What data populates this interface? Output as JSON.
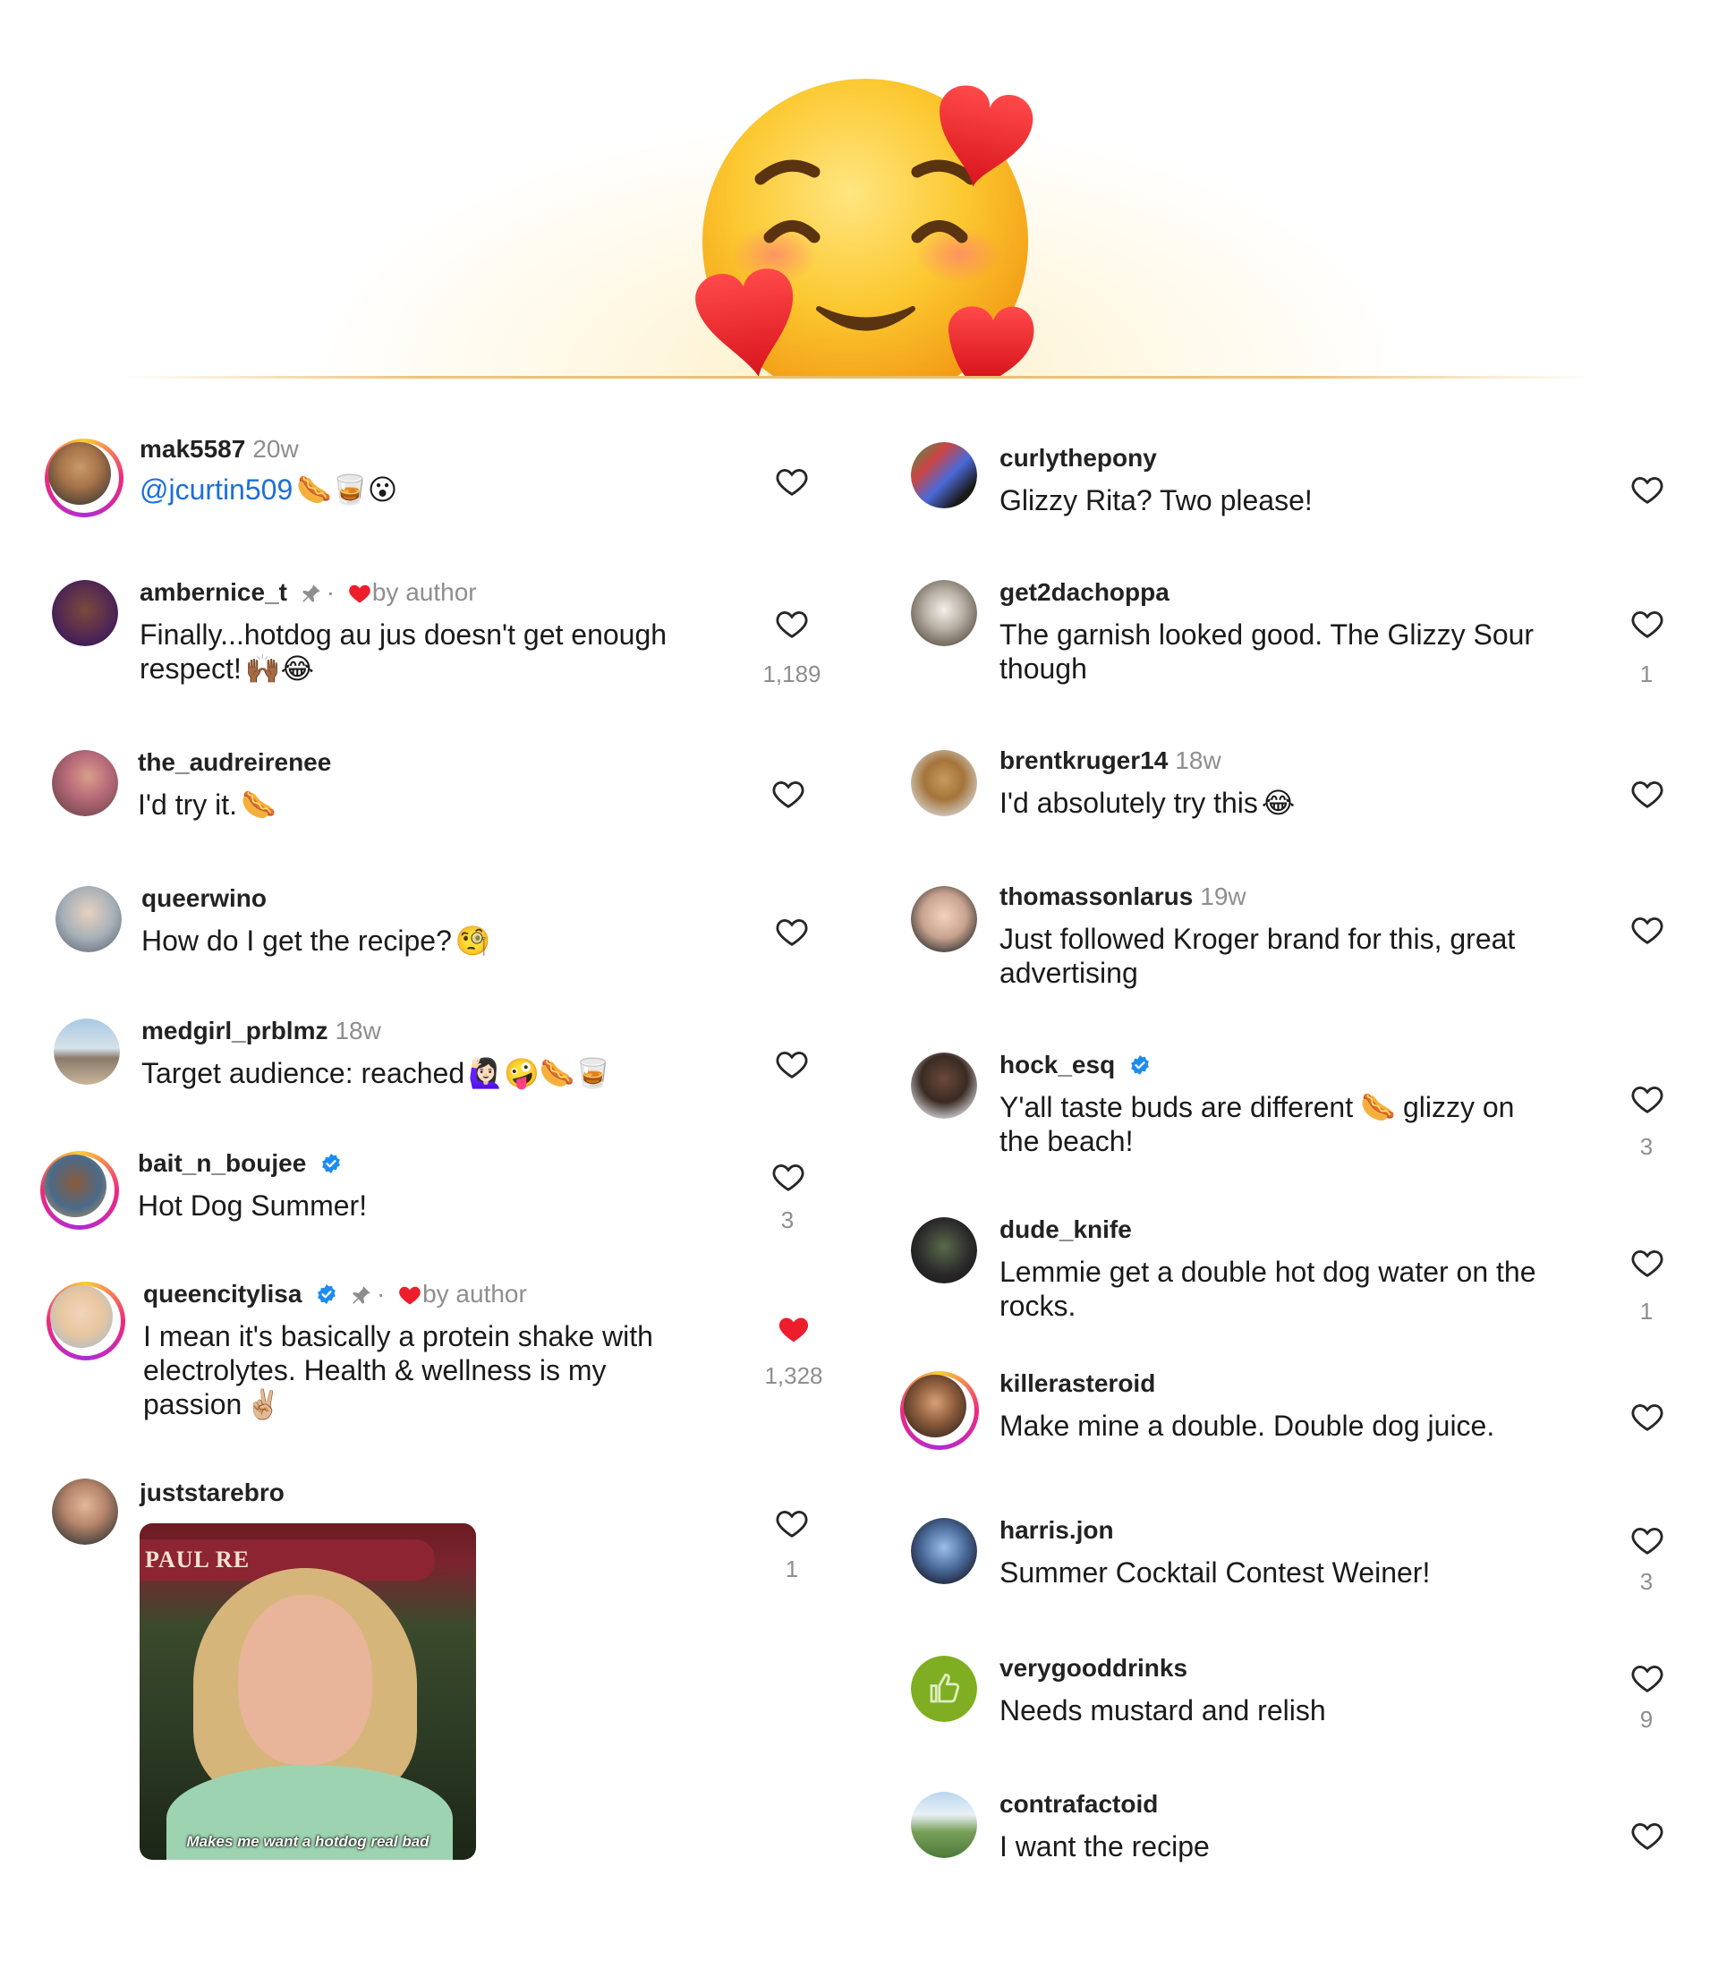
{
  "left_comments": [
    {
      "username": "mak5587",
      "time": "20w",
      "text": "@jcurtin509",
      "mention": true,
      "emoji": "🌭🥃😮",
      "likes": ""
    },
    {
      "username": "ambernice_t",
      "pinned": true,
      "author_liked": "by author",
      "text": "Finally...hotdog au jus doesn't get enough",
      "text2": "respect!",
      "emoji2": "🙌🏾😂",
      "likes": "1,189"
    },
    {
      "username": "the_audreirenee",
      "text": "I'd try it.",
      "emoji": "🌭",
      "likes": ""
    },
    {
      "username": "queerwino",
      "text": "How do I get the recipe?",
      "emoji": "🧐",
      "likes": ""
    },
    {
      "username": "medgirl_prblmz",
      "time": "18w",
      "text": "Target audience: reached",
      "emoji": "🙋🏻‍♀️🤪🌭🥃",
      "likes": ""
    },
    {
      "username": "bait_n_boujee",
      "verified": true,
      "text": "Hot Dog Summer!",
      "likes": "3"
    },
    {
      "username": "queencitylisa",
      "verified": true,
      "pinned": true,
      "author_liked": "by author",
      "text": "I mean it's basically a protein shake with",
      "text2": "electrolytes. Health & wellness is my",
      "text3": "passion",
      "emoji3": "✌🏼",
      "likes": "1,328",
      "liked": true
    },
    {
      "username": "juststarebro",
      "likes": "1",
      "gif_caption": "Makes me want a hotdog real bad",
      "gif_sign": "PAUL RE"
    }
  ],
  "right_comments": [
    {
      "username": "curlythepony",
      "text": "Glizzy Rita? Two please!",
      "likes": ""
    },
    {
      "username": "get2dachoppa",
      "text": "The garnish looked good. The Glizzy Sour",
      "text2": "though",
      "likes": "1"
    },
    {
      "username": "brentkruger14",
      "time": "18w",
      "text": "I'd absolutely try this",
      "emoji": "😂",
      "likes": ""
    },
    {
      "username": "thomassonlarus",
      "time": "19w",
      "text": "Just followed Kroger brand for this, great",
      "text2": "advertising",
      "likes": ""
    },
    {
      "username": "hock_esq",
      "verified": true,
      "text": "Y'all taste buds are different",
      "emoji": "🌭",
      "text_after": "glizzy on",
      "text2": "the beach!",
      "likes": "3"
    },
    {
      "username": "dude_knife",
      "text": "Lemmie get a double hot dog water on the",
      "text2": "rocks.",
      "likes": "1"
    },
    {
      "username": "killerasteroid",
      "text": "Make mine a double. Double dog juice.",
      "likes": ""
    },
    {
      "username": "harris.jon",
      "text": "Summer Cocktail Contest Weiner!",
      "likes": "3"
    },
    {
      "username": "verygooddrinks",
      "text": "Needs mustard and relish",
      "likes": "9"
    },
    {
      "username": "contrafactoid",
      "text": "I want the recipe",
      "likes": ""
    }
  ],
  "colors": {
    "heart_liked": "#ee1d2c",
    "mention": "#1d6fd8",
    "verified": "#1d8cf0"
  }
}
